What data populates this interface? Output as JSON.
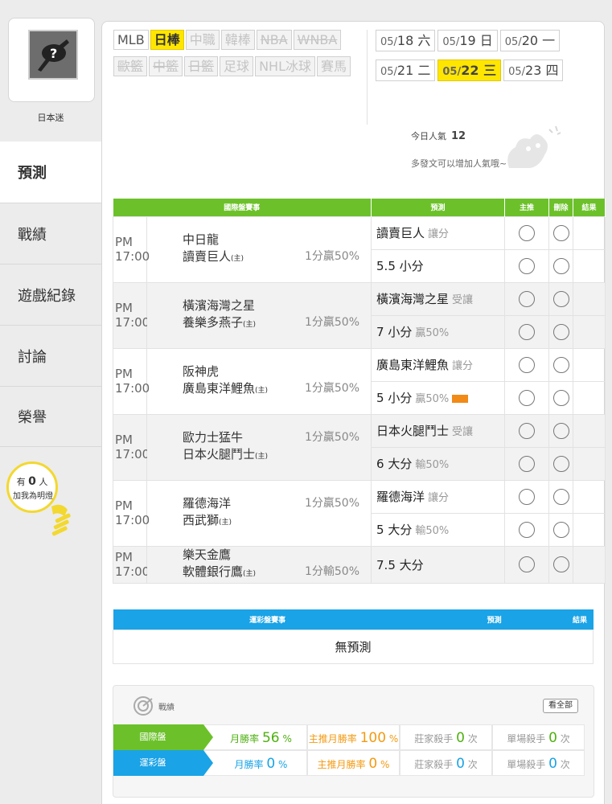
{
  "profile": {
    "username": "日本迷"
  },
  "nav": [
    {
      "label": "預測",
      "active": true
    },
    {
      "label": "戰績"
    },
    {
      "label": "遊戲紀錄"
    },
    {
      "label": "討論"
    },
    {
      "label": "榮譽"
    }
  ],
  "fans": {
    "prefix": "有",
    "count": "0",
    "suffix": "人",
    "line2": "加我為明燈"
  },
  "leagues": [
    {
      "label": "MLB",
      "state": "normal"
    },
    {
      "label": "日棒",
      "state": "selected"
    },
    {
      "label": "中職",
      "state": "disabled"
    },
    {
      "label": "韓棒",
      "state": "disabled"
    },
    {
      "label": "NBA",
      "state": "strike"
    },
    {
      "label": "WNBA",
      "state": "strike"
    },
    {
      "label": "歐籃",
      "state": "strike"
    },
    {
      "label": "中籃",
      "state": "strike"
    },
    {
      "label": "日籃",
      "state": "strike"
    },
    {
      "label": "足球",
      "state": "disabled"
    },
    {
      "label": "NHL冰球",
      "state": "disabled"
    },
    {
      "label": "賽馬",
      "state": "disabled"
    }
  ],
  "dates": [
    {
      "month": "05/",
      "day": "18",
      "weekday": "六"
    },
    {
      "month": "05/",
      "day": "19",
      "weekday": "日"
    },
    {
      "month": "05/",
      "day": "20",
      "weekday": "一"
    },
    {
      "month": "05/",
      "day": "21",
      "weekday": "二"
    },
    {
      "month": "05/",
      "day": "22",
      "weekday": "三",
      "selected": true
    },
    {
      "month": "05/",
      "day": "23",
      "weekday": "四"
    }
  ],
  "popularity": {
    "label": "今日人氣",
    "value": "12",
    "hint": "多發文可以增加人氣哦~"
  },
  "intl": {
    "headers": {
      "event": "國際盤賽事",
      "predict": "預測",
      "main": "主推",
      "delete": "刪除",
      "result": "結果"
    },
    "games": [
      {
        "time": "PM 17:00",
        "away": "中日龍",
        "home": "讀賣巨人",
        "home_tag": "(主)",
        "odds": "1分贏50%",
        "odds_row": 2,
        "picks": [
          {
            "text": "讀賣巨人",
            "sub": "讓分"
          },
          {
            "text": "5.5 小分",
            "sub": ""
          }
        ]
      },
      {
        "time": "PM 17:00",
        "away": "橫濱海灣之星",
        "home": "養樂多燕子",
        "home_tag": "(主)",
        "odds": "1分贏50%",
        "odds_row": 2,
        "picks": [
          {
            "text": "橫濱海灣之星",
            "sub": "受讓"
          },
          {
            "text": "7 小分",
            "sub": "贏50%"
          }
        ]
      },
      {
        "time": "PM 17:00",
        "away": "阪神虎",
        "home": "廣島東洋鯉魚",
        "home_tag": "(主)",
        "odds": "1分贏50%",
        "odds_row": 2,
        "picks": [
          {
            "text": "廣島東洋鯉魚",
            "sub": "讓分"
          },
          {
            "text": "5 小分",
            "sub": "贏50%",
            "badge": true
          }
        ]
      },
      {
        "time": "PM 17:00",
        "away": "歐力士猛牛",
        "home": "日本火腿鬥士",
        "home_tag": "(主)",
        "odds": "1分贏50%",
        "odds_row": 1,
        "picks": [
          {
            "text": "日本火腿鬥士",
            "sub": "受讓"
          },
          {
            "text": "6 大分",
            "sub": "輸50%"
          }
        ]
      },
      {
        "time": "PM 17:00",
        "away": "羅德海洋",
        "home": "西武獅",
        "home_tag": "(主)",
        "odds": "1分贏50%",
        "odds_row": 1,
        "picks": [
          {
            "text": "羅德海洋",
            "sub": "讓分"
          },
          {
            "text": "5 大分",
            "sub": "輸50%"
          }
        ]
      },
      {
        "time": "PM 17:00",
        "away": "樂天金鷹",
        "home": "軟體銀行鷹",
        "home_tag": "(主)",
        "odds": "1分輸50%",
        "odds_row": 2,
        "picks": [
          {
            "text": "7.5 大分",
            "sub": ""
          }
        ]
      }
    ]
  },
  "lottery": {
    "headers": {
      "event": "運彩盤賽事",
      "predict": "預測",
      "result": "結果"
    },
    "empty": "無預測"
  },
  "record": {
    "title": "戰績",
    "view_all": "看全部",
    "rows": [
      {
        "label": "國際盤",
        "monthly_label": "月勝率",
        "monthly": "56",
        "main_label": "主推月勝率",
        "main": "100",
        "pct": "%",
        "killer_label": "莊家殺手",
        "killer": "0",
        "single_label": "單場殺手",
        "single": "0",
        "unit": "次"
      },
      {
        "label": "運彩盤",
        "monthly_label": "月勝率",
        "monthly": "0",
        "main_label": "主推月勝率",
        "main": "0",
        "pct": "%",
        "killer_label": "莊家殺手",
        "killer": "0",
        "single_label": "單場殺手",
        "single": "0",
        "unit": "次"
      }
    ]
  },
  "colors": {
    "green": "#6cc12a",
    "blue": "#1aa3e6",
    "yellow": "#ffe600",
    "orange": "#f39a12"
  }
}
